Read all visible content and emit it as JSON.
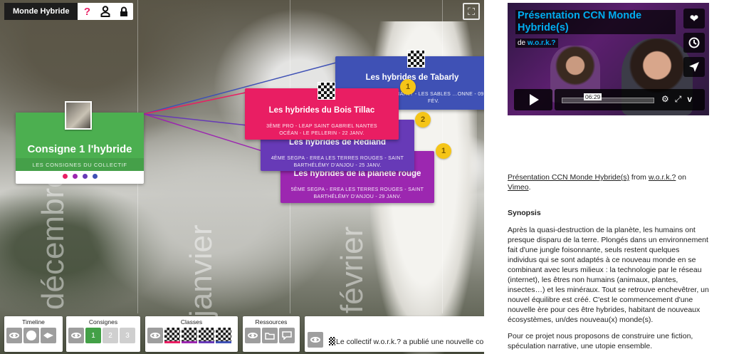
{
  "app": {
    "title": "Monde Hybride"
  },
  "topbar": {
    "icons": [
      {
        "name": "help-icon",
        "glyph": "?",
        "color": "#e91e63"
      },
      {
        "name": "user-icon",
        "glyph": "♙",
        "color": "#111111"
      },
      {
        "name": "lock-icon",
        "glyph": "🔒",
        "color": "#111111"
      }
    ]
  },
  "timeline_months": [
    "décembre",
    "janvier",
    "février"
  ],
  "main_card": {
    "title": "Consigne 1 l'hybride",
    "subtitle": "LES CONSIGNES DU COLLECTIF",
    "dot_colors": [
      "#e91e63",
      "#9c27b0",
      "#673ab7",
      "#3f51b5"
    ]
  },
  "production_cards": [
    {
      "title": "Les hybrides de Tabarly",
      "meta": "… TABARLY - LES SABLES …ONNE - 09 FÉV.",
      "color": "#3f51b5",
      "badge": "1"
    },
    {
      "title": "Les hybrides du Bois Tillac",
      "meta": "3ÈME PRO - LEAP SAINT GABRIEL NANTES OCÉAN - LE PELLERIN - 22 JANV.",
      "color": "#e91e63",
      "badge": "2"
    },
    {
      "title": "Les hybrides de Rediand",
      "meta": "4ÈME SEGPA - EREA LES TERRES ROUGES - SAINT BARTHÉLÉMY D'ANJOU - 25 JANV.",
      "color": "#673ab7",
      "badge": ""
    },
    {
      "title": "Les hybrides de la planète rouge",
      "meta": "5ÈME SEGPA - EREA LES TERRES ROUGES - SAINT BARTHÉLÉMY D'ANJOU - 29 JANV.",
      "color": "#9c27b0",
      "badge": "1"
    }
  ],
  "bottom_panels": {
    "timeline": {
      "label": "Timeline"
    },
    "consignes": {
      "label": "Consignes",
      "items": [
        "1",
        "2",
        "3"
      ]
    },
    "classes": {
      "label": "Classes",
      "colors": [
        "#e91e63",
        "#9c27b0",
        "#673ab7",
        "#3f51b5"
      ]
    },
    "ressources": {
      "label": "Ressources"
    },
    "news": {
      "text": "Le collectif w.o.r.k.? a publié une nouvelle con"
    }
  },
  "video": {
    "title": "Présentation CCN Monde Hybride(s)",
    "by_prefix": "de",
    "by_author": "w.o.r.k.?",
    "time": "06:29",
    "side_icons": [
      "heart-icon",
      "clock-icon",
      "send-icon"
    ]
  },
  "credit": {
    "link_title": "Présentation CCN Monde Hybride(s)",
    "from": " from ",
    "author": "w.o.r.k.?",
    "on": " on ",
    "platform": "Vimeo",
    "end": "."
  },
  "synopsis": {
    "heading": "Synopsis",
    "p1": "Après la quasi-destruction de la planète, les humains ont presque disparu de la terre. Plongés dans un environnement fait d'une jungle foisonnante, seuls restent quelques individus qui se sont adaptés à ce nouveau monde en se combinant avec leurs milieux : la technologie par le réseau (internet), les êtres non humains (animaux, plantes, insectes…) et les minéraux. Tout se retrouve enchevêtrer, un nouvel équilibre est créé. C'est le commencement d'une nouvelle ère pour ces être hybrides, habitant de nouveaux écosystèmes, un/des nouveau(x) monde(s).",
    "p2": "Pour ce projet nous proposons de construire une fiction, spéculation narrative, une utopie ensemble."
  }
}
